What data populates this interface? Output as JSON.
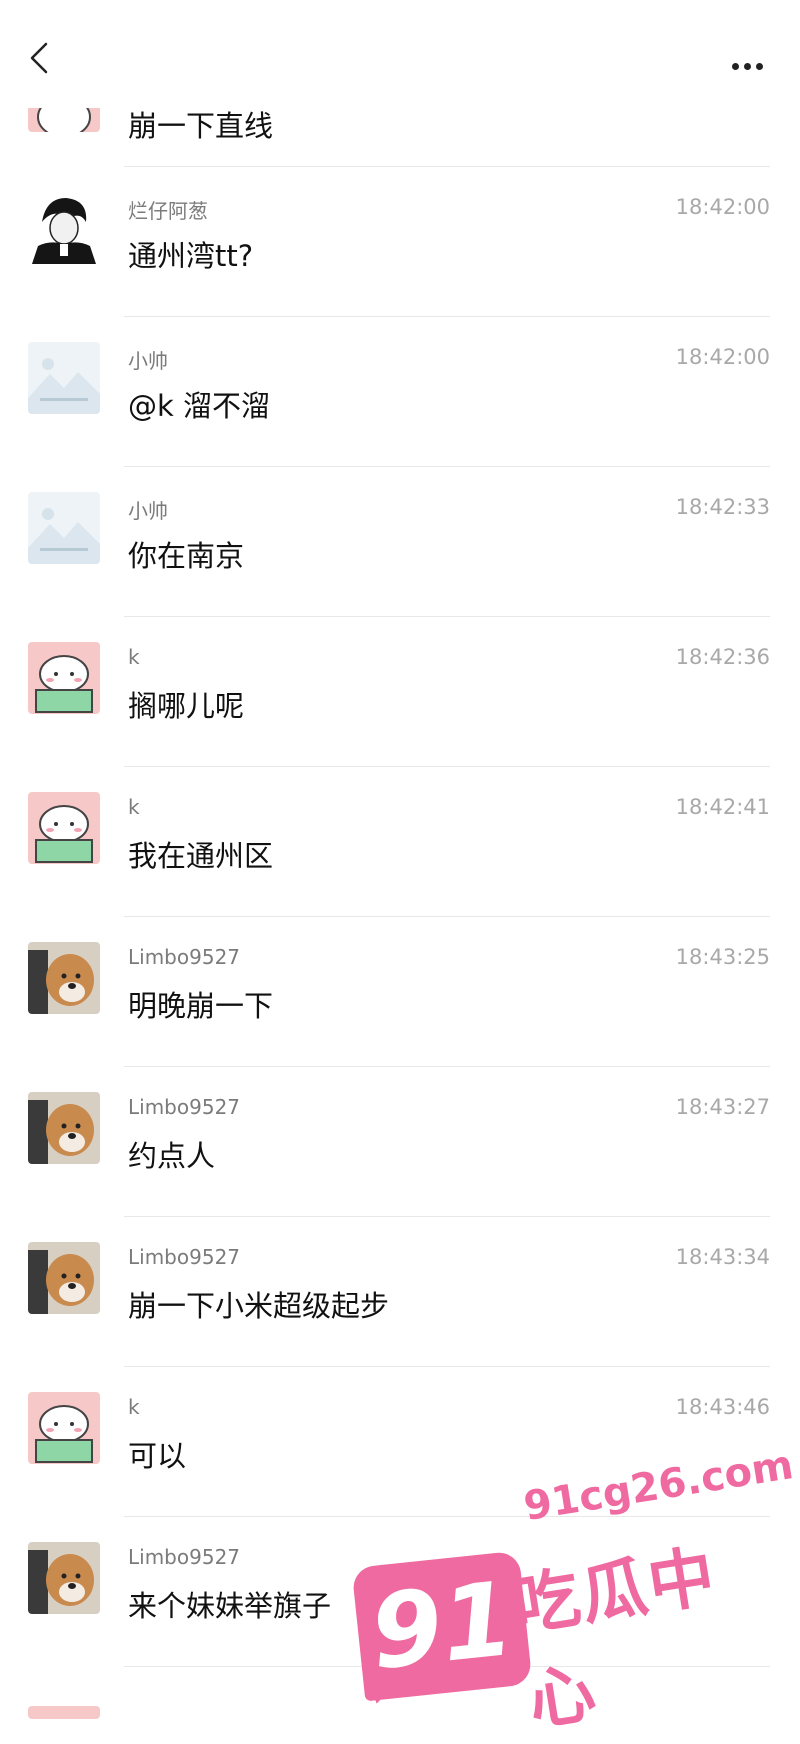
{
  "header": {
    "back_icon": "chevron-left-icon",
    "more_icon": "more-horizontal-icon"
  },
  "messages": [
    {
      "sender": "",
      "time": "",
      "text": "崩一下直线",
      "avatar": "cat-avatar"
    },
    {
      "sender": "烂仔阿葱",
      "time": "18:42:00",
      "text": "通州湾tt?",
      "avatar": "manga-avatar"
    },
    {
      "sender": "小帅",
      "time": "18:42:00",
      "text": "@k 溜不溜",
      "avatar": "default-avatar"
    },
    {
      "sender": "小帅",
      "time": "18:42:33",
      "text": "你在南京",
      "avatar": "default-avatar"
    },
    {
      "sender": "k",
      "time": "18:42:36",
      "text": "搁哪儿呢",
      "avatar": "cat-avatar"
    },
    {
      "sender": "k",
      "time": "18:42:41",
      "text": "我在通州区",
      "avatar": "cat-avatar"
    },
    {
      "sender": "Limbo9527",
      "time": "18:43:25",
      "text": "明晚崩一下",
      "avatar": "dog-avatar"
    },
    {
      "sender": "Limbo9527",
      "time": "18:43:27",
      "text": "约点人",
      "avatar": "dog-avatar"
    },
    {
      "sender": "Limbo9527",
      "time": "18:43:34",
      "text": "崩一下小米超级起步",
      "avatar": "dog-avatar"
    },
    {
      "sender": "k",
      "time": "18:43:46",
      "text": "可以",
      "avatar": "cat-avatar"
    },
    {
      "sender": "Limbo9527",
      "time": "",
      "text": "来个妹妹举旗子",
      "avatar": "dog-avatar"
    }
  ],
  "watermark": {
    "badge": "91",
    "url": "91cg26.com",
    "name": "吃瓜中心"
  },
  "colors": {
    "watermark_pink": "#ef6aa0",
    "text_primary": "#111111",
    "text_secondary": "#7b7b7b",
    "time_gray": "#a8a8a8",
    "divider": "#e8e8e8"
  }
}
